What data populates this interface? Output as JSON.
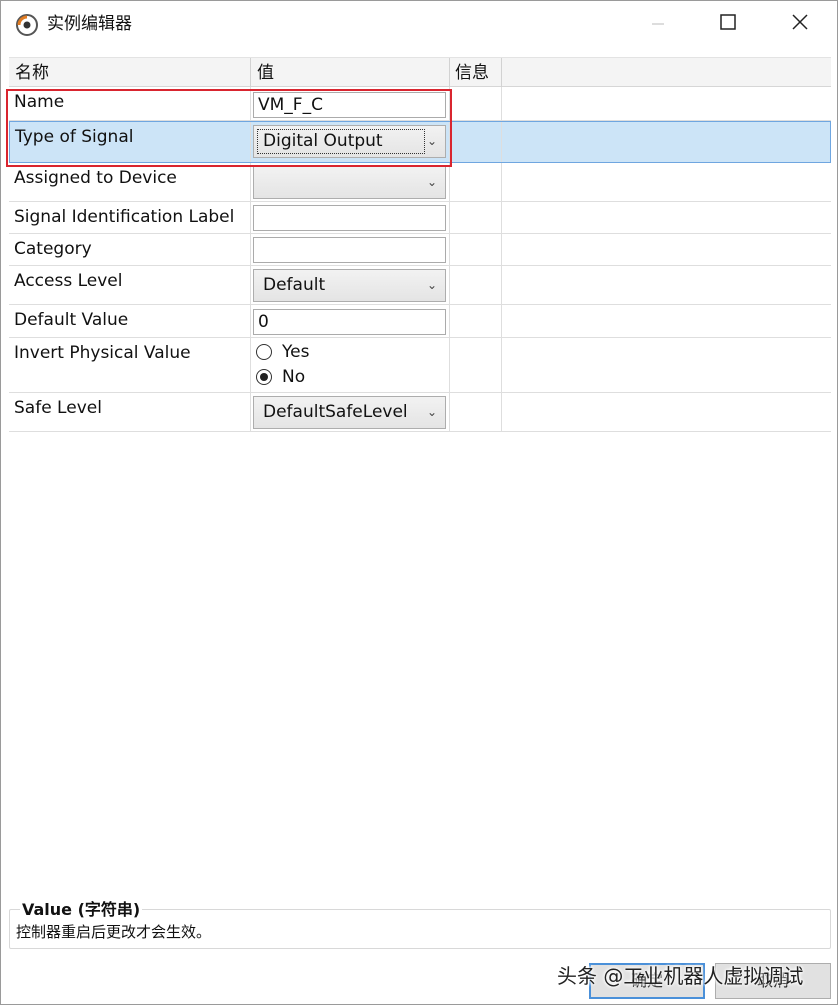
{
  "window": {
    "title": "实例编辑器",
    "icon": "robotstudio-app-icon"
  },
  "grid": {
    "headers": {
      "name": "名称",
      "value": "值",
      "info": "信息"
    },
    "rows": {
      "name": {
        "label": "Name",
        "value": "VM_F_C"
      },
      "type_of_signal": {
        "label": "Type of Signal",
        "value": "Digital Output"
      },
      "assigned_to_device": {
        "label": "Assigned to Device",
        "value": ""
      },
      "signal_identification_label": {
        "label": "Signal Identification Label",
        "value": ""
      },
      "category": {
        "label": "Category",
        "value": ""
      },
      "access_level": {
        "label": "Access Level",
        "value": "Default"
      },
      "default_value": {
        "label": "Default Value",
        "value": "0"
      },
      "invert_physical_value": {
        "label": "Invert Physical Value",
        "options": [
          "Yes",
          "No"
        ],
        "selected": "No"
      },
      "safe_level": {
        "label": "Safe Level",
        "value": "DefaultSafeLevel"
      }
    }
  },
  "info_panel": {
    "title": "Value (字符串)",
    "description": "控制器重启后更改才会生效。"
  },
  "buttons": {
    "ok": "确定",
    "cancel": "取消"
  },
  "watermark": "头条 @工业机器人虚拟调试",
  "colors": {
    "selected_row": "#cce4f7",
    "highlight_border": "#d9252f",
    "focus_button": "#4a90d9"
  }
}
